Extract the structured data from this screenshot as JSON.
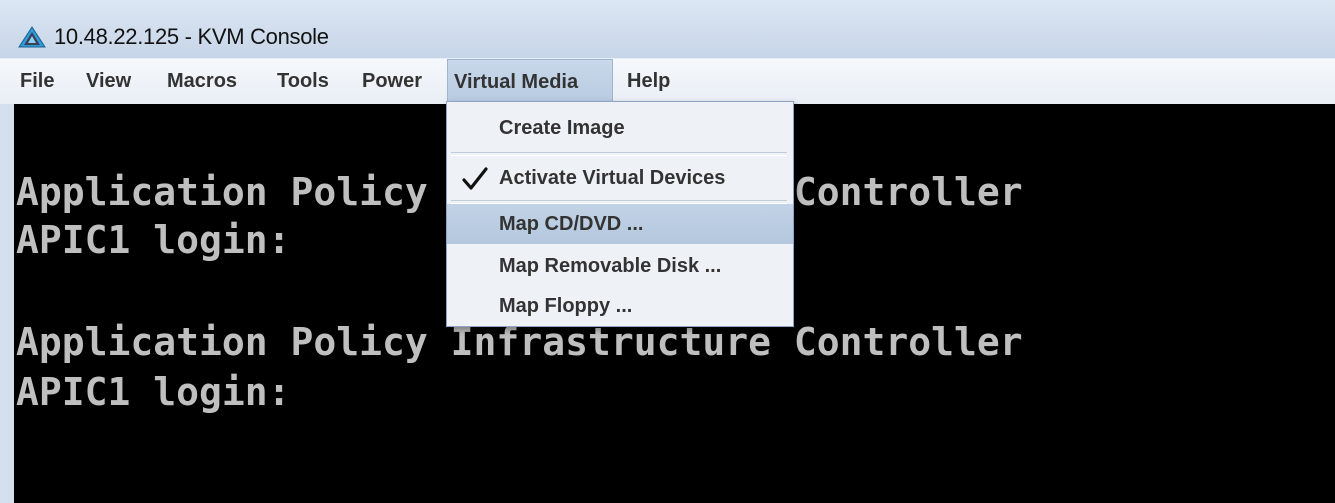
{
  "window": {
    "title": "10.48.22.125 - KVM Console",
    "icon": "kvm-triangle-icon"
  },
  "menubar": {
    "items": [
      {
        "label": "File"
      },
      {
        "label": "View"
      },
      {
        "label": "Macros"
      },
      {
        "label": "Tools"
      },
      {
        "label": "Power"
      },
      {
        "label": "Virtual Media",
        "active": true
      },
      {
        "label": "Help"
      }
    ]
  },
  "virtual_media_menu": {
    "items": [
      {
        "label": "Create Image"
      },
      {
        "label": "Activate Virtual Devices",
        "checked": true,
        "icon": "checkmark-icon"
      },
      {
        "label": "Map CD/DVD ...",
        "highlighted": true
      },
      {
        "label": "Map Removable Disk ..."
      },
      {
        "label": "Map Floppy ..."
      }
    ]
  },
  "console": {
    "lines": [
      "Application Policy Infrastructure Controller",
      "APIC1 login:",
      "",
      "Application Policy Infrastructure Controller",
      "APIC1 login:"
    ],
    "text_color": "#bfbfbf",
    "background": "#000000"
  }
}
